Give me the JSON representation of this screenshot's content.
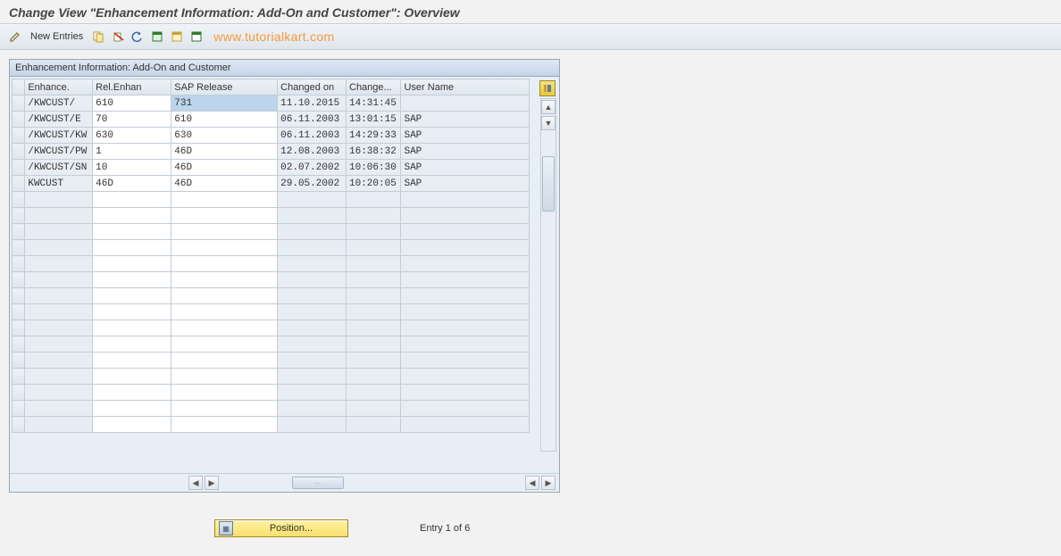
{
  "title": "Change View \"Enhancement Information: Add-On and Customer\": Overview",
  "toolbar": {
    "new_entries_label": "New Entries"
  },
  "watermark": "www.tutorialkart.com",
  "panel": {
    "header": "Enhancement Information: Add-On and Customer"
  },
  "columns": {
    "enhance": "Enhance.",
    "rel_enhan": "Rel.Enhan",
    "sap_release": "SAP Release",
    "changed_on": "Changed on",
    "changed_at": "Change...",
    "user_name": "User Name"
  },
  "rows": [
    {
      "enhance": "/KWCUST/",
      "rel_enhan": "610",
      "sap_release": "731",
      "changed_on": "11.10.2015",
      "changed_at": "14:31:45",
      "user_name": ""
    },
    {
      "enhance": "/KWCUST/E",
      "rel_enhan": "70",
      "sap_release": "610",
      "changed_on": "06.11.2003",
      "changed_at": "13:01:15",
      "user_name": "SAP"
    },
    {
      "enhance": "/KWCUST/KW",
      "rel_enhan": "630",
      "sap_release": "630",
      "changed_on": "06.11.2003",
      "changed_at": "14:29:33",
      "user_name": "SAP"
    },
    {
      "enhance": "/KWCUST/PW",
      "rel_enhan": "1",
      "sap_release": "46D",
      "changed_on": "12.08.2003",
      "changed_at": "16:38:32",
      "user_name": "SAP"
    },
    {
      "enhance": "/KWCUST/SN",
      "rel_enhan": "10",
      "sap_release": "46D",
      "changed_on": "02.07.2002",
      "changed_at": "10:06:30",
      "user_name": "SAP"
    },
    {
      "enhance": "KWCUST",
      "rel_enhan": "46D",
      "sap_release": "46D",
      "changed_on": "29.05.2002",
      "changed_at": "10:20:05",
      "user_name": "SAP"
    }
  ],
  "footer": {
    "position_label": "Position...",
    "entry_info": "Entry 1 of 6"
  }
}
